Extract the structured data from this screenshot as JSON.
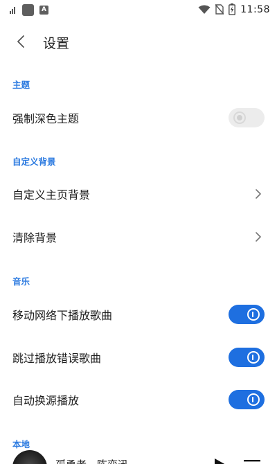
{
  "status_bar": {
    "time": "11:58",
    "icons": [
      "signal-bars-icon",
      "notification-square-icon",
      "app-a-icon",
      "wifi-icon",
      "no-sim-icon",
      "battery-charging-icon"
    ],
    "app_badge_letter": "A"
  },
  "header": {
    "back_icon": "chevron-left-icon",
    "title": "设置"
  },
  "sections": {
    "theme": {
      "header": "主题",
      "items": [
        {
          "label": "强制深色主题",
          "control": "toggle",
          "on": false
        }
      ]
    },
    "custom_background": {
      "header": "自定义背景",
      "items": [
        {
          "label": "自定义主页背景",
          "control": "chevron"
        },
        {
          "label": "清除背景",
          "control": "chevron"
        }
      ]
    },
    "music": {
      "header": "音乐",
      "items": [
        {
          "label": "移动网络下播放歌曲",
          "control": "toggle",
          "on": true
        },
        {
          "label": "跳过播放错误歌曲",
          "control": "toggle",
          "on": true
        },
        {
          "label": "自动换源播放",
          "control": "toggle",
          "on": true
        }
      ]
    },
    "local": {
      "header": "本地"
    }
  },
  "mini_player": {
    "title": "孤勇者 - 陈奕迅",
    "icons": [
      "album-art",
      "play-icon",
      "playlist-icon"
    ]
  },
  "colors": {
    "accent": "#1e6fe0",
    "section_header": "#2d7be0",
    "toggle_off": "#ececec"
  }
}
